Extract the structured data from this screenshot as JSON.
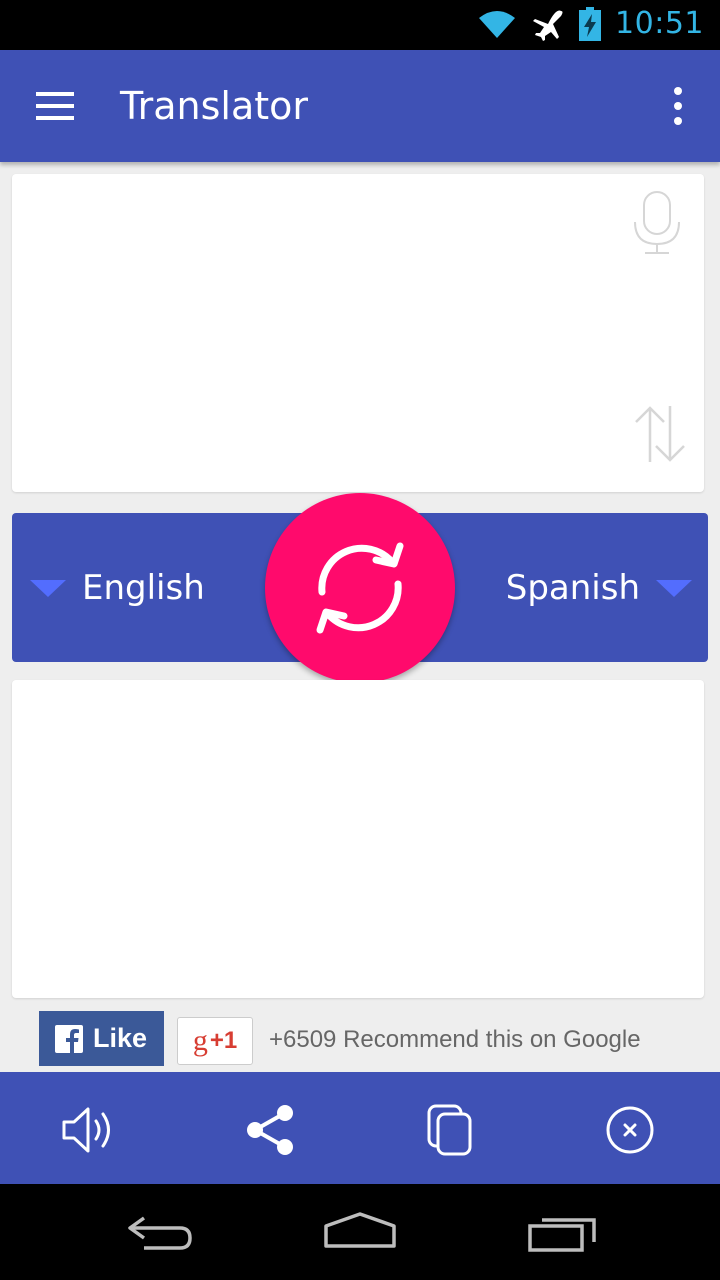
{
  "status_bar": {
    "time": "10:51",
    "icons": [
      "wifi-icon",
      "airplane-icon",
      "battery-charging-icon"
    ]
  },
  "app_bar": {
    "title": "Translator",
    "menu_icon": "hamburger-menu-icon",
    "overflow_icon": "more-vert-icon"
  },
  "input": {
    "text": "",
    "icons": [
      "microphone-icon",
      "swap-vertical-icon"
    ]
  },
  "language_bar": {
    "source": "English",
    "target": "Spanish",
    "swap_icon": "refresh-swap-icon"
  },
  "output": {
    "text": ""
  },
  "social": {
    "facebook_label": "Like",
    "gplus_label": "+1",
    "gplus_g": "g",
    "recommend_text": "+6509 Recommend this on Google"
  },
  "bottom_actions": [
    "volume-icon",
    "share-icon",
    "copy-icon",
    "clear-icon"
  ],
  "colors": {
    "primary": "#3f51b5",
    "accent": "#ff0a6c",
    "status_text": "#33b5e5",
    "dropdown_arrow": "#536dfe"
  }
}
